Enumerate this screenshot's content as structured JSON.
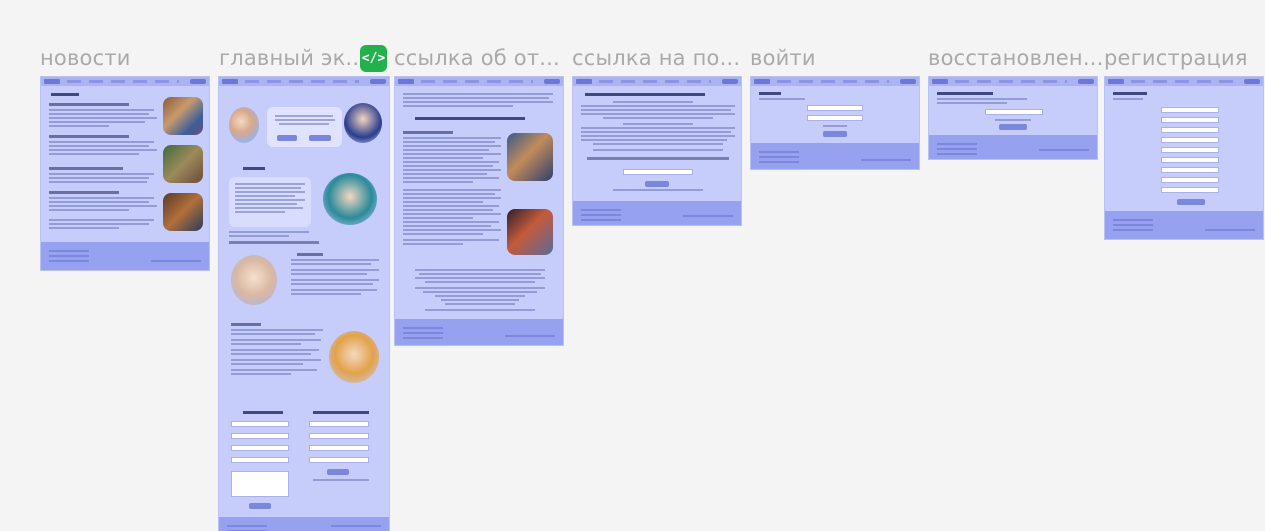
{
  "frames": [
    {
      "id": "news",
      "title": "новости"
    },
    {
      "id": "main",
      "title": "главный эк..."
    },
    {
      "id": "about",
      "title": "ссылка об от..."
    },
    {
      "id": "help",
      "title": "ссылка на по..."
    },
    {
      "id": "login",
      "title": "войти"
    },
    {
      "id": "restore",
      "title": "восстановлен..."
    },
    {
      "id": "register",
      "title": "регистрация"
    }
  ],
  "dev_mode": {
    "label": "</>"
  },
  "colors": {
    "frame_bg": "#c7cdfa",
    "footer_bg": "#96a2f0",
    "badge_green": "#22b14c",
    "title_gray": "#a9a9a9"
  }
}
